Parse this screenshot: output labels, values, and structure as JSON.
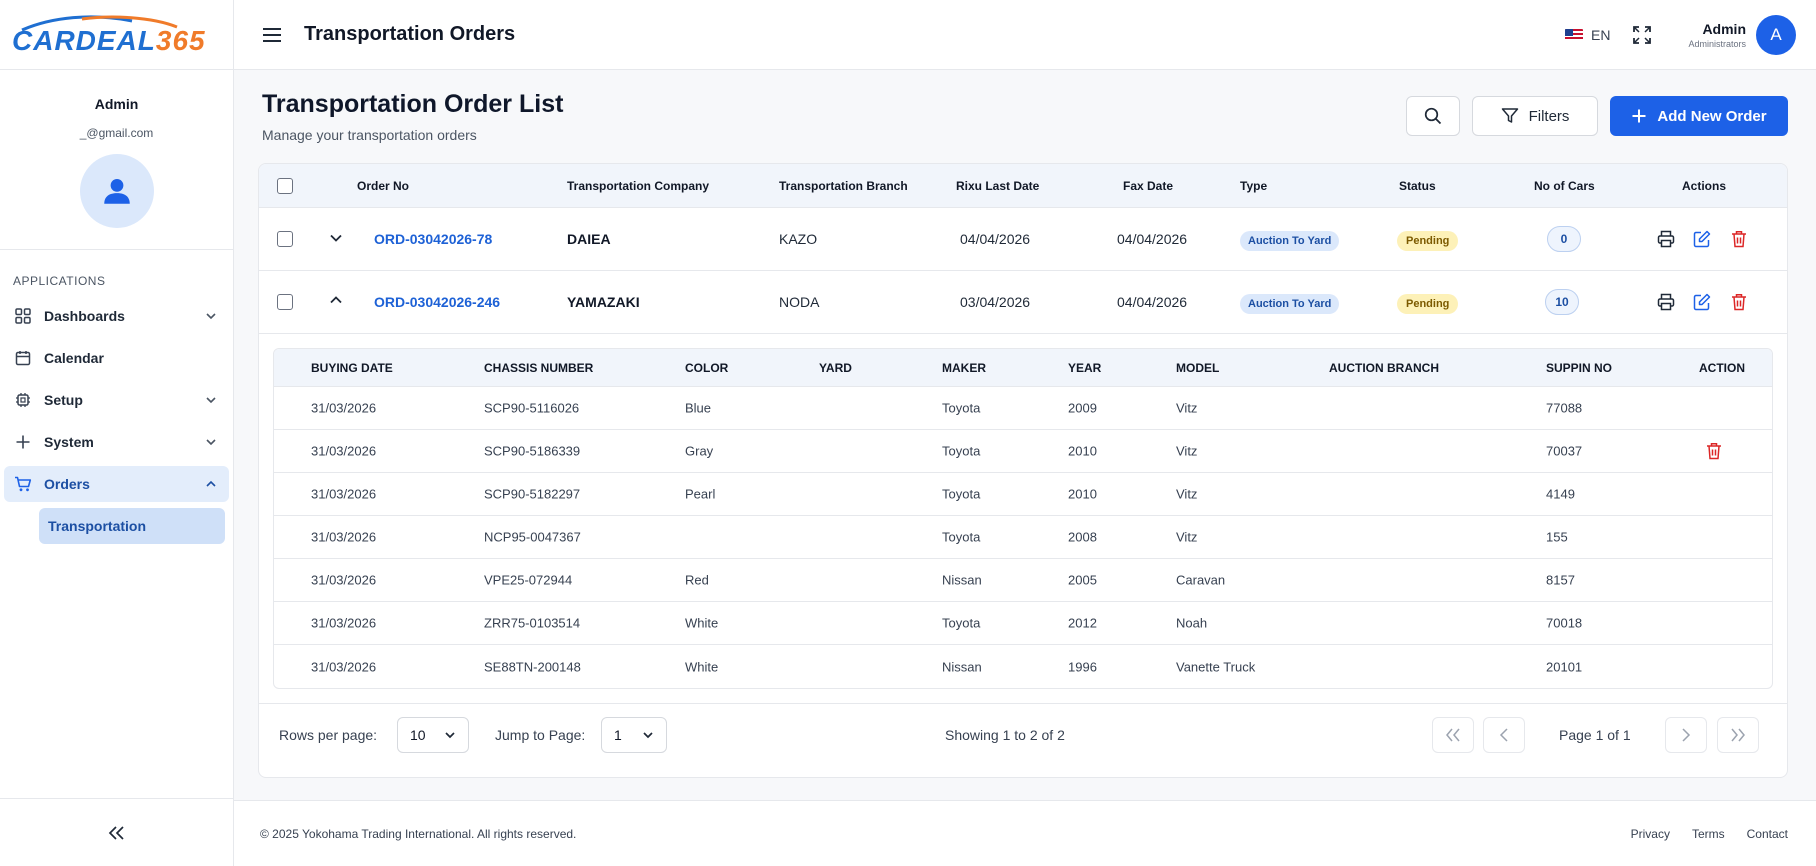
{
  "app": {
    "logo_part1": "CARDEAL",
    "logo_part2": "365",
    "brand_blue": "#1f6fd1",
    "brand_orange": "#f07b2a"
  },
  "header": {
    "title": "Transportation Orders",
    "language": "EN",
    "user_name": "Admin",
    "user_role": "Administrators",
    "avatar_letter": "A"
  },
  "sidebar": {
    "profile_name": "Admin",
    "profile_email": "_@gmail.com",
    "section_label": "APPLICATIONS",
    "items": [
      {
        "label": "Dashboards",
        "icon": "grid-icon"
      },
      {
        "label": "Calendar",
        "icon": "calendar-icon"
      },
      {
        "label": "Setup",
        "icon": "chip-icon"
      },
      {
        "label": "System",
        "icon": "plus-icon"
      },
      {
        "label": "Orders",
        "icon": "cart-icon"
      }
    ],
    "sub_item": "Transportation"
  },
  "page": {
    "title": "Transportation Order List",
    "subtitle": "Manage your transportation orders",
    "filters_label": "Filters",
    "add_label": "Add New Order"
  },
  "table": {
    "columns": [
      "Order No",
      "Transportation Company",
      "Transportation Branch",
      "Rixu Last Date",
      "Fax Date",
      "Type",
      "Status",
      "No of Cars",
      "Actions"
    ],
    "rows": [
      {
        "order_no": "ORD-03042026-78",
        "company": "DAIEA",
        "branch": "KAZO",
        "rixu_date": "04/04/2026",
        "fax_date": "04/04/2026",
        "type": "Auction To Yard",
        "status": "Pending",
        "cars": "0"
      },
      {
        "order_no": "ORD-03042026-246",
        "company": "YAMAZAKI",
        "branch": "NODA",
        "rixu_date": "03/04/2026",
        "fax_date": "04/04/2026",
        "type": "Auction To Yard",
        "status": "Pending",
        "cars": "10"
      }
    ]
  },
  "detail": {
    "columns": [
      "BUYING DATE",
      "CHASSIS NUMBER",
      "COLOR",
      "YARD",
      "MAKER",
      "YEAR",
      "MODEL",
      "AUCTION BRANCH",
      "SUPPIN NO",
      "ACTION"
    ],
    "rows": [
      {
        "buying_date": "31/03/2026",
        "chassis": "SCP90-5116026",
        "color": "Blue",
        "yard": "",
        "maker": "Toyota",
        "year": "2009",
        "model": "Vitz",
        "branch": "",
        "suppin": "77088"
      },
      {
        "buying_date": "31/03/2026",
        "chassis": "SCP90-5186339",
        "color": "Gray",
        "yard": "",
        "maker": "Toyota",
        "year": "2010",
        "model": "Vitz",
        "branch": "",
        "suppin": "70037"
      },
      {
        "buying_date": "31/03/2026",
        "chassis": "SCP90-5182297",
        "color": "Pearl",
        "yard": "",
        "maker": "Toyota",
        "year": "2010",
        "model": "Vitz",
        "branch": "",
        "suppin": "4149"
      },
      {
        "buying_date": "31/03/2026",
        "chassis": "NCP95-0047367",
        "color": "",
        "yard": "",
        "maker": "Toyota",
        "year": "2008",
        "model": "Vitz",
        "branch": "",
        "suppin": "155"
      },
      {
        "buying_date": "31/03/2026",
        "chassis": "VPE25-072944",
        "color": "Red",
        "yard": "",
        "maker": "Nissan",
        "year": "2005",
        "model": "Caravan",
        "branch": "",
        "suppin": "8157"
      },
      {
        "buying_date": "31/03/2026",
        "chassis": "ZRR75-0103514",
        "color": "White",
        "yard": "",
        "maker": "Toyota",
        "year": "2012",
        "model": "Noah",
        "branch": "",
        "suppin": "70018"
      },
      {
        "buying_date": "31/03/2026",
        "chassis": "SE88TN-200148",
        "color": "White",
        "yard": "",
        "maker": "Nissan",
        "year": "1996",
        "model": "Vanette Truck",
        "branch": "",
        "suppin": "20101"
      }
    ]
  },
  "pagination": {
    "rows_label": "Rows per page:",
    "rows_value": "10",
    "jump_label": "Jump to Page:",
    "jump_value": "1",
    "showing": "Showing 1 to 2 of 2",
    "page_text": "Page 1 of 1"
  },
  "footer": {
    "copyright": "© 2025 Yokohama Trading International. All rights reserved.",
    "links": [
      "Privacy",
      "Terms",
      "Contact"
    ]
  },
  "colors": {
    "primary": "#1d61e7",
    "danger": "#dc2626",
    "pending_bg": "#fdf1b8"
  }
}
